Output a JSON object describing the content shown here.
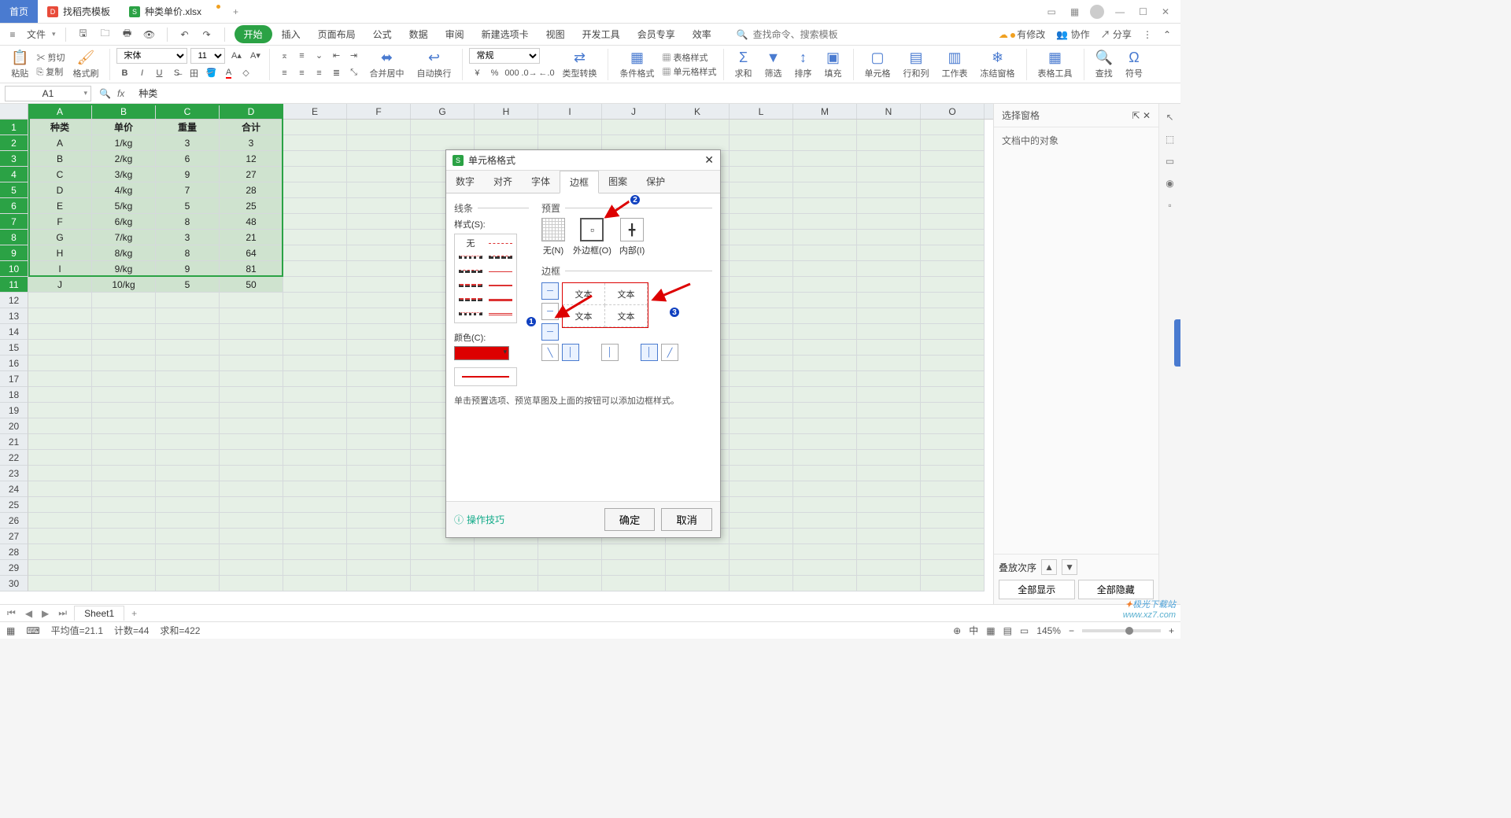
{
  "titlebar": {
    "home": "首页",
    "tab1": "找稻壳模板",
    "tab2": "种类单价.xlsx",
    "add": "+"
  },
  "menubar": {
    "file": "文件",
    "items": [
      "开始",
      "插入",
      "页面布局",
      "公式",
      "数据",
      "审阅",
      "新建选项卡",
      "视图",
      "开发工具",
      "会员专享",
      "效率"
    ],
    "search_icon": "Q",
    "search_placeholder": "查找命令、搜索模板",
    "right": {
      "changes": "有修改",
      "coop": "协作",
      "share": "分享"
    }
  },
  "ribbon": {
    "paste": "粘贴",
    "cut": "剪切",
    "copy": "复制",
    "fmtpaint": "格式刷",
    "font": "宋体",
    "fontsize": "11",
    "merge": "合并居中",
    "wrap": "自动换行",
    "general": "常规",
    "typecvt": "类型转换",
    "condfmt": "条件格式",
    "tblstyle": "表格样式",
    "cellstyle": "单元格样式",
    "sum": "求和",
    "filter": "筛选",
    "sort": "排序",
    "fill": "填充",
    "cells": "单元格",
    "rowcol": "行和列",
    "sheet": "工作表",
    "freeze": "冻结窗格",
    "tabletool": "表格工具",
    "find": "查找",
    "symbol": "符号"
  },
  "formulabar": {
    "name": "A1",
    "fx": "fx",
    "value": "种类"
  },
  "columns": [
    "A",
    "B",
    "C",
    "D",
    "E",
    "F",
    "G",
    "H",
    "I",
    "J",
    "K",
    "L",
    "M",
    "N",
    "O"
  ],
  "rows": [
    1,
    2,
    3,
    4,
    5,
    6,
    7,
    8,
    9,
    10,
    11,
    12,
    13,
    14,
    15,
    16,
    17,
    18,
    19,
    20,
    21,
    22,
    23,
    24,
    25,
    26,
    27,
    28,
    29,
    30
  ],
  "table": {
    "headers": [
      "种类",
      "单价",
      "重量",
      "合计"
    ],
    "data": [
      [
        "A",
        "1/kg",
        "3",
        "3"
      ],
      [
        "B",
        "2/kg",
        "6",
        "12"
      ],
      [
        "C",
        "3/kg",
        "9",
        "27"
      ],
      [
        "D",
        "4/kg",
        "7",
        "28"
      ],
      [
        "E",
        "5/kg",
        "5",
        "25"
      ],
      [
        "F",
        "6/kg",
        "8",
        "48"
      ],
      [
        "G",
        "7/kg",
        "3",
        "21"
      ],
      [
        "H",
        "8/kg",
        "8",
        "64"
      ],
      [
        "I",
        "9/kg",
        "9",
        "81"
      ],
      [
        "J",
        "10/kg",
        "5",
        "50"
      ]
    ]
  },
  "rightpane": {
    "title": "选择窗格",
    "subtitle": "文档中的对象",
    "order": "叠放次序",
    "show": "全部显示",
    "hide": "全部隐藏"
  },
  "sheettabs": {
    "name": "Sheet1"
  },
  "statusbar": {
    "avg": "平均值=21.1",
    "count": "计数=44",
    "sum": "求和=422",
    "zoom": "145%"
  },
  "dialog": {
    "title": "单元格格式",
    "tabs": [
      "数字",
      "对齐",
      "字体",
      "边框",
      "图案",
      "保护"
    ],
    "line_section": "线条",
    "preset_section": "预置",
    "style_label": "样式(S):",
    "none": "无",
    "color_label": "颜色(C):",
    "preset": {
      "none": "无(N)",
      "outer": "外边框(O)",
      "inner": "内部(I)"
    },
    "border_section": "边框",
    "preview_text": "文本",
    "hint": "单击预置选项、预览草图及上面的按钮可以添加边框样式。",
    "tips": "操作技巧",
    "ok": "确定",
    "cancel": "取消"
  },
  "badges": {
    "b1": "1",
    "b2": "2",
    "b3": "3"
  },
  "watermark": {
    "brand": "极光下载站",
    "url": "www.xz7.com"
  }
}
